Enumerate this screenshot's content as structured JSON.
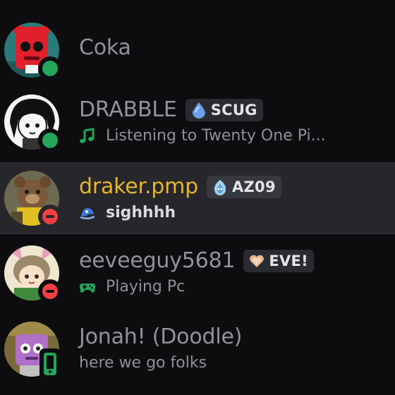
{
  "members": [
    {
      "name": "Coka",
      "status": "online",
      "avatar_icon": "red-creature-avatar"
    },
    {
      "name": "DRABBLE",
      "status": "online",
      "avatar_icon": "black-haired-character-avatar",
      "tag": {
        "text": "SCUG",
        "icon": "water-drop-icon",
        "color": "#6aa2f0"
      },
      "activity": {
        "icon": "music-note-icon",
        "text": "Listening to Twenty One Pi..."
      }
    },
    {
      "name": "draker.pmp",
      "status": "dnd",
      "highlighted": true,
      "avatar_icon": "bear-character-avatar",
      "tag": {
        "text": "AZ09",
        "icon": "spirit-flame-icon",
        "color": "#9fd0f0"
      },
      "activity": {
        "icon": "custom-emoji-icon",
        "text": "sighhhh"
      }
    },
    {
      "name": "eeveeguy5681",
      "status": "dnd",
      "avatar_icon": "cat-girl-avatar",
      "tag": {
        "text": "EVE!",
        "icon": "heart-icon",
        "color": "#e6b48a"
      },
      "activity": {
        "icon": "gamepad-icon",
        "text": "Playing Pc"
      }
    },
    {
      "name": "Jonah! (Doodle)",
      "status": "mobile",
      "avatar_icon": "purple-character-avatar",
      "activity": {
        "icon": "",
        "text": "here we go folks"
      }
    }
  ],
  "colors": {
    "background": "#0d0d0f",
    "active_row": "#26262b",
    "name_default": "#909399",
    "name_highlight": "#e7b52a",
    "online": "#23a55a",
    "dnd": "#f23f43"
  }
}
